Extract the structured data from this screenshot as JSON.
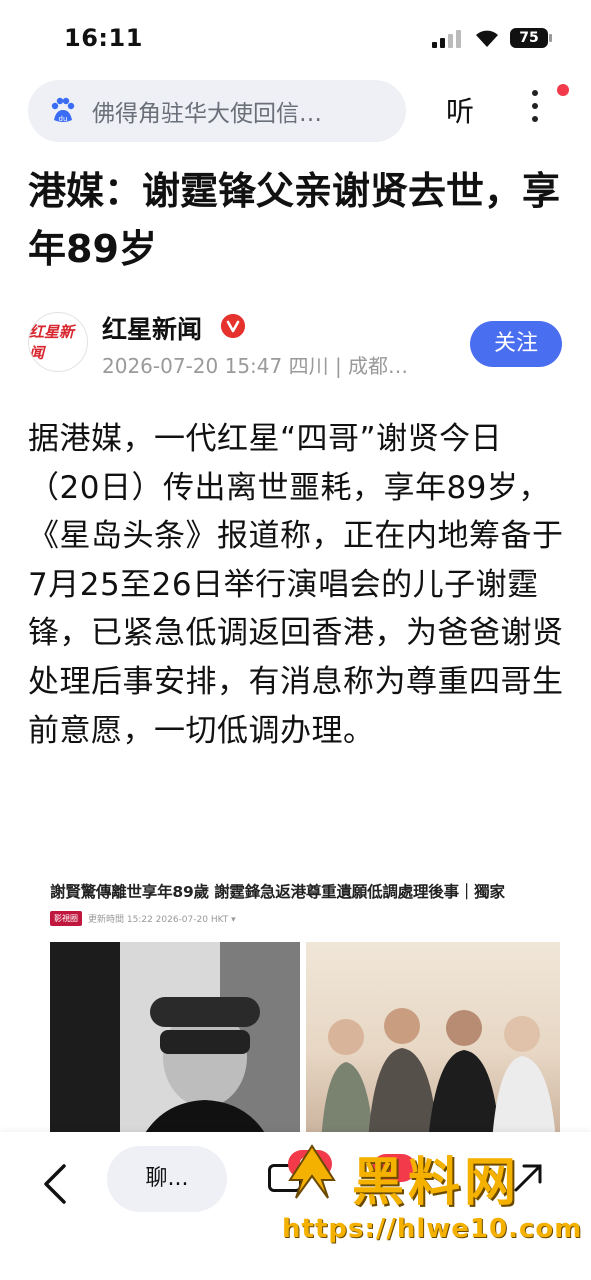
{
  "status": {
    "time": "16:11",
    "battery": "75"
  },
  "search": {
    "text": "佛得角驻华大使回信…",
    "listen": "听"
  },
  "article": {
    "title": "港媒：谢霆锋父亲谢贤去世，享年89岁",
    "source": {
      "avatar_text": "红星新闻",
      "name": "红星新闻",
      "meta": "2026-07-20 15:47  四川 | 成都…",
      "follow": "关注"
    },
    "body": "据港媒，一代红星“四哥”谢贤今日（20日）传出离世噩耗，享年89岁，《星岛头条》报道称，正在内地筹备于7月25至26日举行演唱会的儿子谢霆锋，已紧急低调返回香港，为爸爸谢贤处理后事安排，有消息称为尊重四哥生前意愿，一切低调办理。",
    "image": {
      "headline": "謝賢驚傳離世享年89歲 謝霆鋒急返港尊重遺願低調處理後事｜獨家",
      "badge": "影視圈",
      "meta": "更新時間  15:22 2026-07-20 HKT ▾"
    }
  },
  "bottom": {
    "chat": "聊...",
    "comment_count": "63",
    "like_count": ""
  },
  "watermark": {
    "text": "黑料网",
    "url": "https://hlwe10.com"
  },
  "colors": {
    "accent": "#4a6ef0",
    "badge": "#f23a4a",
    "watermark": "#f5b100"
  },
  "icons": [
    "baidu-paw-icon",
    "more-icon",
    "verified-icon",
    "back-icon",
    "comment-icon",
    "like-icon",
    "share-icon",
    "signal-icon",
    "wifi-icon",
    "battery-icon"
  ]
}
